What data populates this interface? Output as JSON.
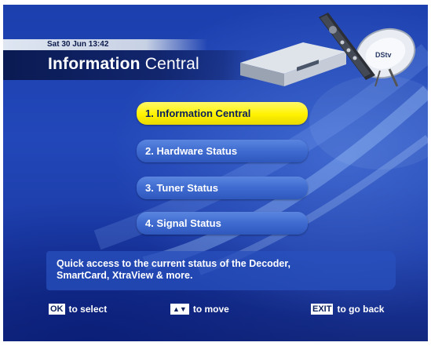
{
  "header": {
    "datetime": "Sat 30 Jun 13:42",
    "title_bold": "Information",
    "title_light": " Central",
    "device_image": "decoder-remote-dish-icon",
    "dish_logo": "DStv"
  },
  "menu": {
    "items": [
      {
        "label": "1. Information Central",
        "selected": true
      },
      {
        "label": "2. Hardware Status",
        "selected": false
      },
      {
        "label": "3. Tuner Status",
        "selected": false
      },
      {
        "label": "4. Signal Status",
        "selected": false
      }
    ]
  },
  "description": {
    "line1": "Quick access to the current status of the Decoder,",
    "line2": "SmartCard, XtraView & more."
  },
  "footer": {
    "ok_key": "OK",
    "ok_text": "to select",
    "move_key": "▲▼",
    "move_text": "to move",
    "exit_key": "EXIT",
    "exit_text": "to go back"
  },
  "colors": {
    "background": "#1f44b2",
    "selected_item": "#fff200",
    "menu_item": "#3f6bd0",
    "title_bar": "#0a1a52"
  }
}
